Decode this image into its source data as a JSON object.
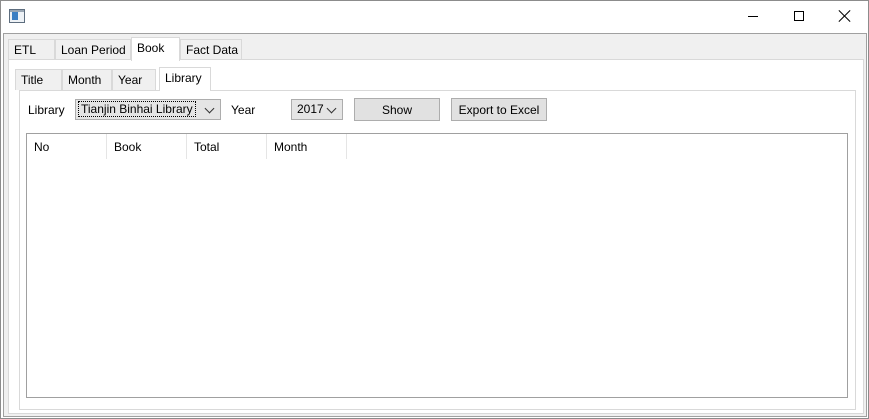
{
  "window": {
    "title": ""
  },
  "outer_tabs": [
    {
      "label": "ETL"
    },
    {
      "label": "Loan Period"
    },
    {
      "label": "Book"
    },
    {
      "label": "Fact Data"
    }
  ],
  "inner_tabs": [
    {
      "label": "Title"
    },
    {
      "label": "Month"
    },
    {
      "label": "Year"
    },
    {
      "label": "Library"
    }
  ],
  "filters": {
    "library_label": "Library",
    "library_value": "Tianjin Binhai Library",
    "year_label": "Year",
    "year_value": "2017",
    "show_label": "Show",
    "export_label": "Export to Excel"
  },
  "grid": {
    "columns": [
      "No",
      "Book",
      "Total",
      "Month"
    ],
    "rows": []
  }
}
